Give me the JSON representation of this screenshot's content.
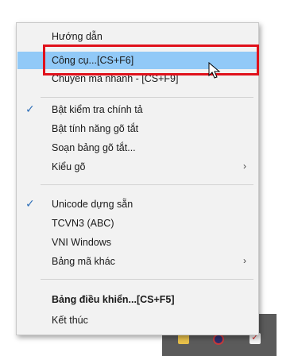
{
  "menu": {
    "items": [
      {
        "label": "Hướng dẫn"
      },
      {
        "label": "Công cụ...[CS+F6]"
      },
      {
        "label": "Chuyển mã nhanh - [CS+F9]"
      },
      {
        "label": "Bật kiểm tra chính tả",
        "checked": true
      },
      {
        "label": "Bật tính năng gõ tắt"
      },
      {
        "label": "Soạn bảng gõ tắt..."
      },
      {
        "label": "Kiểu gõ",
        "submenu": true
      },
      {
        "label": "Unicode dựng sẵn",
        "checked": true
      },
      {
        "label": "TCVN3 (ABC)"
      },
      {
        "label": "VNI Windows"
      },
      {
        "label": "Bảng mã khác",
        "submenu": true
      },
      {
        "label": "Bảng điều khiển...[CS+F5]"
      },
      {
        "label": "Kết thúc"
      }
    ],
    "highlighted_index": 1
  },
  "glyphs": {
    "check": "✓",
    "submenu_arrow": "›"
  },
  "colors": {
    "highlight": "#91c9f7",
    "annotation_box": "#e0111b",
    "check": "#2e6fb8"
  }
}
